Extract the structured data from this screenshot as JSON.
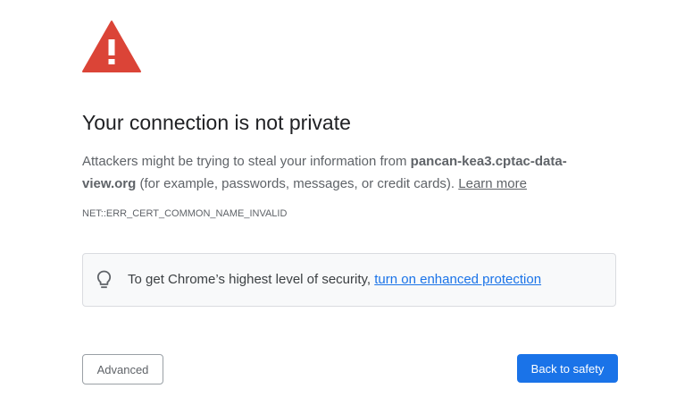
{
  "icons": {
    "warning": "warning-triangle-icon",
    "bulb": "lightbulb-icon"
  },
  "colors": {
    "warning_red": "#db4437",
    "link_blue": "#1a73e8",
    "primary_button": "#1a73e8",
    "box_background": "#f8f9fa"
  },
  "interstitial": {
    "title": "Your connection is not private",
    "explanation_prefix": "Attackers might be trying to steal your information from ",
    "host": "pancan-kea3.cptac-data-view.org",
    "explanation_suffix": " (for example, passwords, messages, or credit cards). ",
    "learn_more": "Learn more",
    "error_code": "NET::ERR_CERT_COMMON_NAME_INVALID"
  },
  "enhanced_protection": {
    "text": "To get Chrome’s highest level of security, ",
    "link": "turn on enhanced protection"
  },
  "buttons": {
    "advanced": "Advanced",
    "back_to_safety": "Back to safety"
  }
}
